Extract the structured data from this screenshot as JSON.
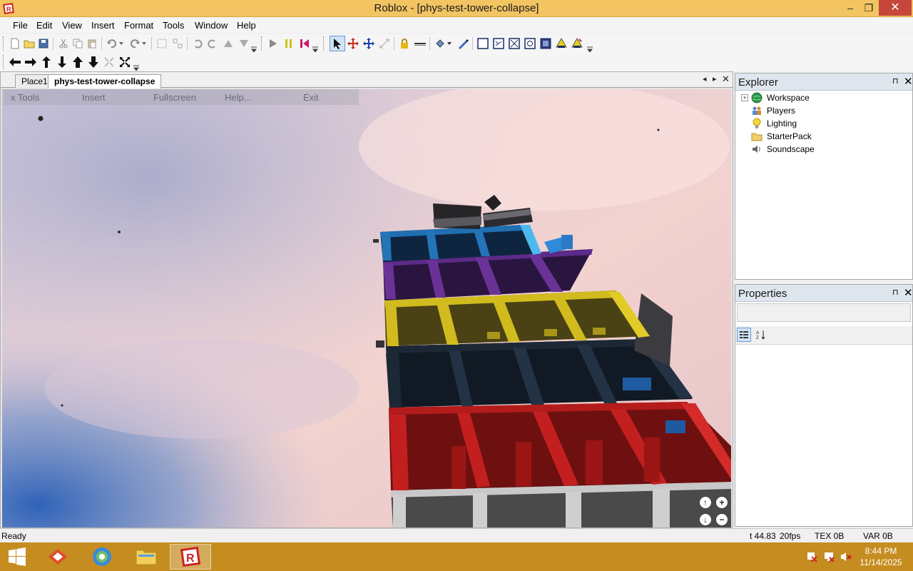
{
  "window": {
    "title": "Roblox - [phys-test-tower-collapse]",
    "minimize": "–",
    "maximize": "❐",
    "close": "✕"
  },
  "menu": {
    "items": [
      "File",
      "Edit",
      "View",
      "Insert",
      "Format",
      "Tools",
      "Window",
      "Help"
    ]
  },
  "toolbar1": {
    "icons": [
      "new-icon",
      "open-icon",
      "save-icon",
      "cut-icon",
      "copy-icon",
      "paste-icon",
      "undo-icon",
      "redo-icon",
      "group-icon",
      "ungroup-icon",
      "rotate-left-icon",
      "rotate-right-icon",
      "tilt-up-icon",
      "tilt-down-icon",
      "play-icon",
      "pause-icon",
      "reset-icon",
      "select-icon",
      "move-icon",
      "drag-icon",
      "resize-icon",
      "lock-icon",
      "anchor-icon",
      "fill-color-icon",
      "material-icon",
      "surface-smooth-icon",
      "surface-glue-icon",
      "surface-weld-icon",
      "surface-studs-icon",
      "surface-inlet-icon",
      "surface-hinge-icon",
      "surface-motor-icon"
    ]
  },
  "toolbar2": {
    "icons": [
      "camera-left-icon",
      "camera-right-icon",
      "camera-up-icon",
      "camera-down-icon",
      "camera-top-icon",
      "camera-bottom-icon",
      "zoom-fit-icon",
      "zoom-extents-icon"
    ]
  },
  "tabs": {
    "items": [
      {
        "label": "Place1",
        "active": false
      },
      {
        "label": "phys-test-tower-collapse",
        "active": true
      }
    ],
    "prev": "◂",
    "next": "▸",
    "close": "✕"
  },
  "viewport_menu": {
    "items": [
      "x Tools",
      "Insert",
      "Fullscreen",
      "Help...",
      "Exit"
    ]
  },
  "camera_nav": {
    "up": "↑",
    "zoom_in": "+",
    "down": "↓",
    "zoom_out": "−"
  },
  "explorer": {
    "title": "Explorer",
    "pin": "⊓",
    "close": "✕",
    "items": [
      {
        "label": "Workspace",
        "expandable": true,
        "icon": "globe-icon"
      },
      {
        "label": "Players",
        "expandable": false,
        "icon": "players-icon"
      },
      {
        "label": "Lighting",
        "expandable": false,
        "icon": "lightbulb-icon"
      },
      {
        "label": "StarterPack",
        "expandable": false,
        "icon": "folder-icon"
      },
      {
        "label": "Soundscape",
        "expandable": false,
        "icon": "speaker-icon"
      }
    ]
  },
  "properties": {
    "title": "Properties",
    "pin": "⊓",
    "close": "✕"
  },
  "status": {
    "ready": "Ready",
    "time": "t 44.83",
    "fps": "20fps",
    "tex": "TEX 0B",
    "var": "VAR 0B"
  },
  "taskbar": {
    "time": "8:44 PM",
    "date": "11/14/2025"
  },
  "colors": {
    "titlebar": "#f2c462",
    "taskbar": "#c58d1f",
    "close_button": "#c7463b"
  }
}
